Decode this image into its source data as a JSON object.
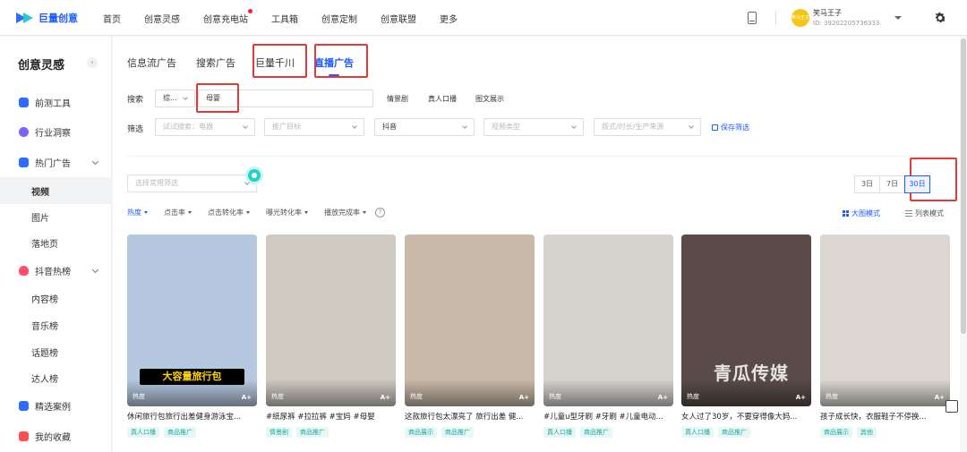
{
  "brand": {
    "logo_text": "巨量创意"
  },
  "topnav": {
    "items": [
      "首页",
      "创意灵感",
      "创意充电站",
      "工具箱",
      "创意定制",
      "创意联盟",
      "更多"
    ]
  },
  "user": {
    "name": "笑马王子",
    "id": "ID: 3920220573633​3",
    "avatar_text": "笑马王子"
  },
  "sidebar": {
    "title": "创意灵感",
    "collapse": "‹",
    "items": [
      {
        "label": "前测工具",
        "color": "#2f6bff"
      },
      {
        "label": "行业洞察",
        "color": "#7b61ff"
      },
      {
        "label": "热门广告",
        "color": "#2f6bff"
      },
      {
        "label": "视频"
      },
      {
        "label": "图片"
      },
      {
        "label": "落地页"
      },
      {
        "label": "抖音热榜",
        "color": "#ff4d6a"
      },
      {
        "label": "内容榜"
      },
      {
        "label": "音乐榜"
      },
      {
        "label": "话题榜"
      },
      {
        "label": "达人榜"
      },
      {
        "label": "精选案例",
        "color": "#2f6bff"
      },
      {
        "label": "我的收藏",
        "color": "#ff4d4f"
      }
    ]
  },
  "tabs": [
    "信息流广告",
    "搜索广告",
    "巨量千川",
    "直播广告"
  ],
  "search": {
    "label": "搜索",
    "type_value": "综...",
    "keyword": "母婴",
    "chips": [
      "情景剧",
      "真人口播",
      "图文展示"
    ]
  },
  "filter": {
    "label": "筛选",
    "industry_placeholder": "试试搜索：电器",
    "goal_placeholder": "推广目标",
    "platform_value": "抖音",
    "video_type_placeholder": "视频类型",
    "format_placeholder": "版式/时长/生产来源",
    "save_label": "保存筛选"
  },
  "preset": {
    "placeholder": "选择常用筛选"
  },
  "days": [
    "3日",
    "7日",
    "30日"
  ],
  "sorts": [
    "热度",
    "点击率",
    "点击转化率",
    "曝光转化率",
    "播放完成率"
  ],
  "help": "?",
  "modes": {
    "grid": "大图模式",
    "list": "列表模式"
  },
  "cards": [
    {
      "title": "休闲旅行包旅行出差健身游泳宝...",
      "hot": "热度",
      "grade": "A+",
      "caption": "大容量旅行包",
      "tags": [
        "真人口播",
        "商品推广"
      ],
      "bg": "#b5c8e0"
    },
    {
      "title": "#纸尿裤 #拉拉裤 #宝妈 #母婴",
      "hot": "热度",
      "grade": "A+",
      "caption": "",
      "tags": [
        "情景剧",
        "商品推广"
      ],
      "bg": "#cfc9c0"
    },
    {
      "title": "这款旅行包太漂亮了 旅行出差 健...",
      "hot": "热度",
      "grade": "A+",
      "caption": "",
      "tags": [
        "商品展示",
        "商品推广"
      ],
      "bg": "#c9b9a8"
    },
    {
      "title": "#儿童u型牙刷 #牙刷 #儿童电动...",
      "hot": "热度",
      "grade": "A+",
      "caption": "",
      "tags": [
        "真人口播",
        "商品推广"
      ],
      "bg": "#d6d3cf"
    },
    {
      "title": "女人过了30岁，不要穿得像大妈...",
      "hot": "热度",
      "grade": "A+",
      "caption": "",
      "tags": [
        "真人口播",
        "商品推广"
      ],
      "bg": "#5a4b48"
    },
    {
      "title": "孩子成长快，衣服鞋子不停换...",
      "hot": "热度",
      "grade": "A+",
      "caption": "",
      "tags": [
        "商品展示",
        "其他"
      ],
      "bg": "#dcd6d0"
    }
  ],
  "watermark": "青瓜传媒"
}
